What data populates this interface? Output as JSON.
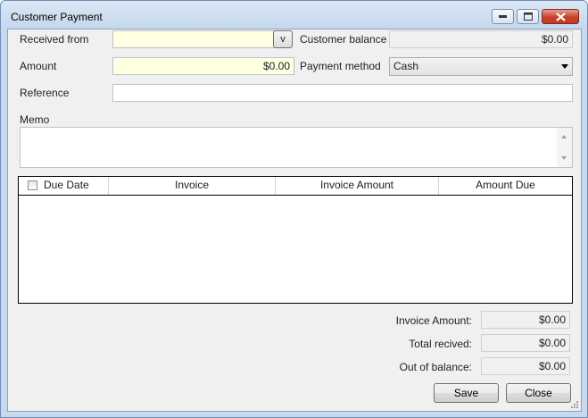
{
  "window": {
    "title": "Customer Payment"
  },
  "form": {
    "received_from_label": "Received from",
    "received_from_value": "",
    "received_from_dropdown": "v",
    "customer_balance_label": "Customer balance",
    "customer_balance_value": "$0.00",
    "amount_label": "Amount",
    "amount_value": "$0.00",
    "payment_method_label": "Payment method",
    "payment_method_value": "Cash",
    "reference_label": "Reference",
    "reference_value": "",
    "memo_label": "Memo",
    "memo_value": ""
  },
  "grid": {
    "columns": [
      "Due Date",
      "Invoice",
      "Invoice Amount",
      "Amount Due"
    ],
    "rows": []
  },
  "totals": {
    "invoice_amount_label": "Invoice Amount:",
    "invoice_amount_value": "$0.00",
    "total_received_label": "Total recived:",
    "total_received_value": "$0.00",
    "out_of_balance_label": "Out of balance:",
    "out_of_balance_value": "$0.00"
  },
  "buttons": {
    "save": "Save",
    "close": "Close"
  }
}
